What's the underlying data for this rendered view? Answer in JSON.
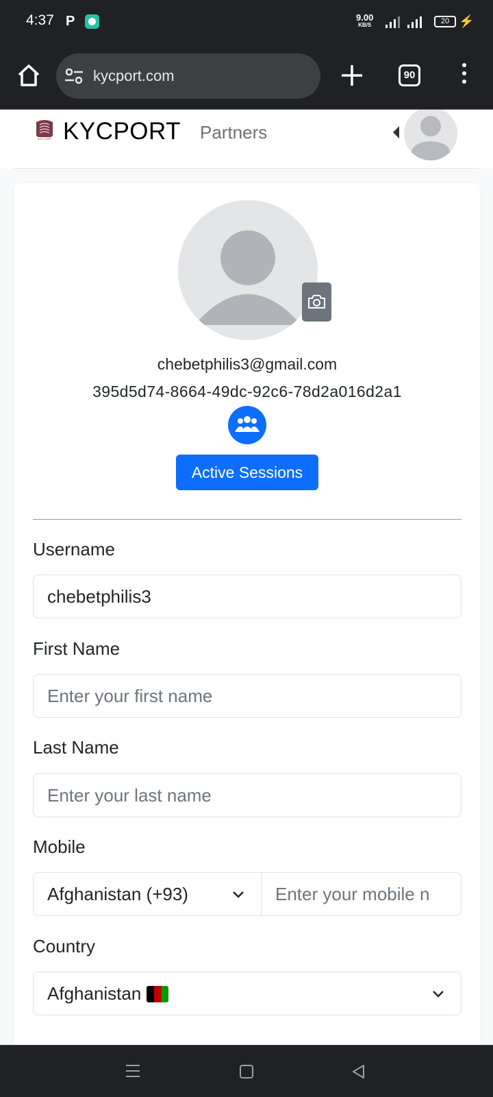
{
  "status_bar": {
    "time": "4:37",
    "notification_p": "P",
    "net_speed_value": "9.00",
    "net_speed_unit": "KB/S",
    "battery": "20"
  },
  "browser": {
    "url": "kycport.com",
    "tab_count": "90"
  },
  "navbar": {
    "brand": "KYCPORT",
    "partners_link": "Partners"
  },
  "profile": {
    "email": "chebetphilis3@gmail.com",
    "user_id": "395d5d74-8664-49dc-92c6-78d2a016d2a1",
    "active_sessions_label": "Active Sessions"
  },
  "form": {
    "username_label": "Username",
    "username_value": "chebetphilis3",
    "first_name_label": "First Name",
    "first_name_placeholder": "Enter your first name",
    "last_name_label": "Last Name",
    "last_name_placeholder": "Enter your last name",
    "mobile_label": "Mobile",
    "mobile_country_code": "Afghanistan (+93)",
    "mobile_placeholder": "Enter your mobile n",
    "country_label": "Country",
    "country_value": "Afghanistan"
  },
  "colors": {
    "primary": "#0d6efd",
    "secondary": "#6c757d",
    "chrome_dark": "#202124"
  },
  "icons": [
    "home-icon",
    "site-settings-icon",
    "plus-icon",
    "tabs-icon",
    "more-vert-icon",
    "camera-icon",
    "team-icon",
    "chevron-down-icon",
    "flag-afghanistan-icon",
    "menu-nav-icon",
    "home-nav-icon",
    "back-nav-icon"
  ]
}
